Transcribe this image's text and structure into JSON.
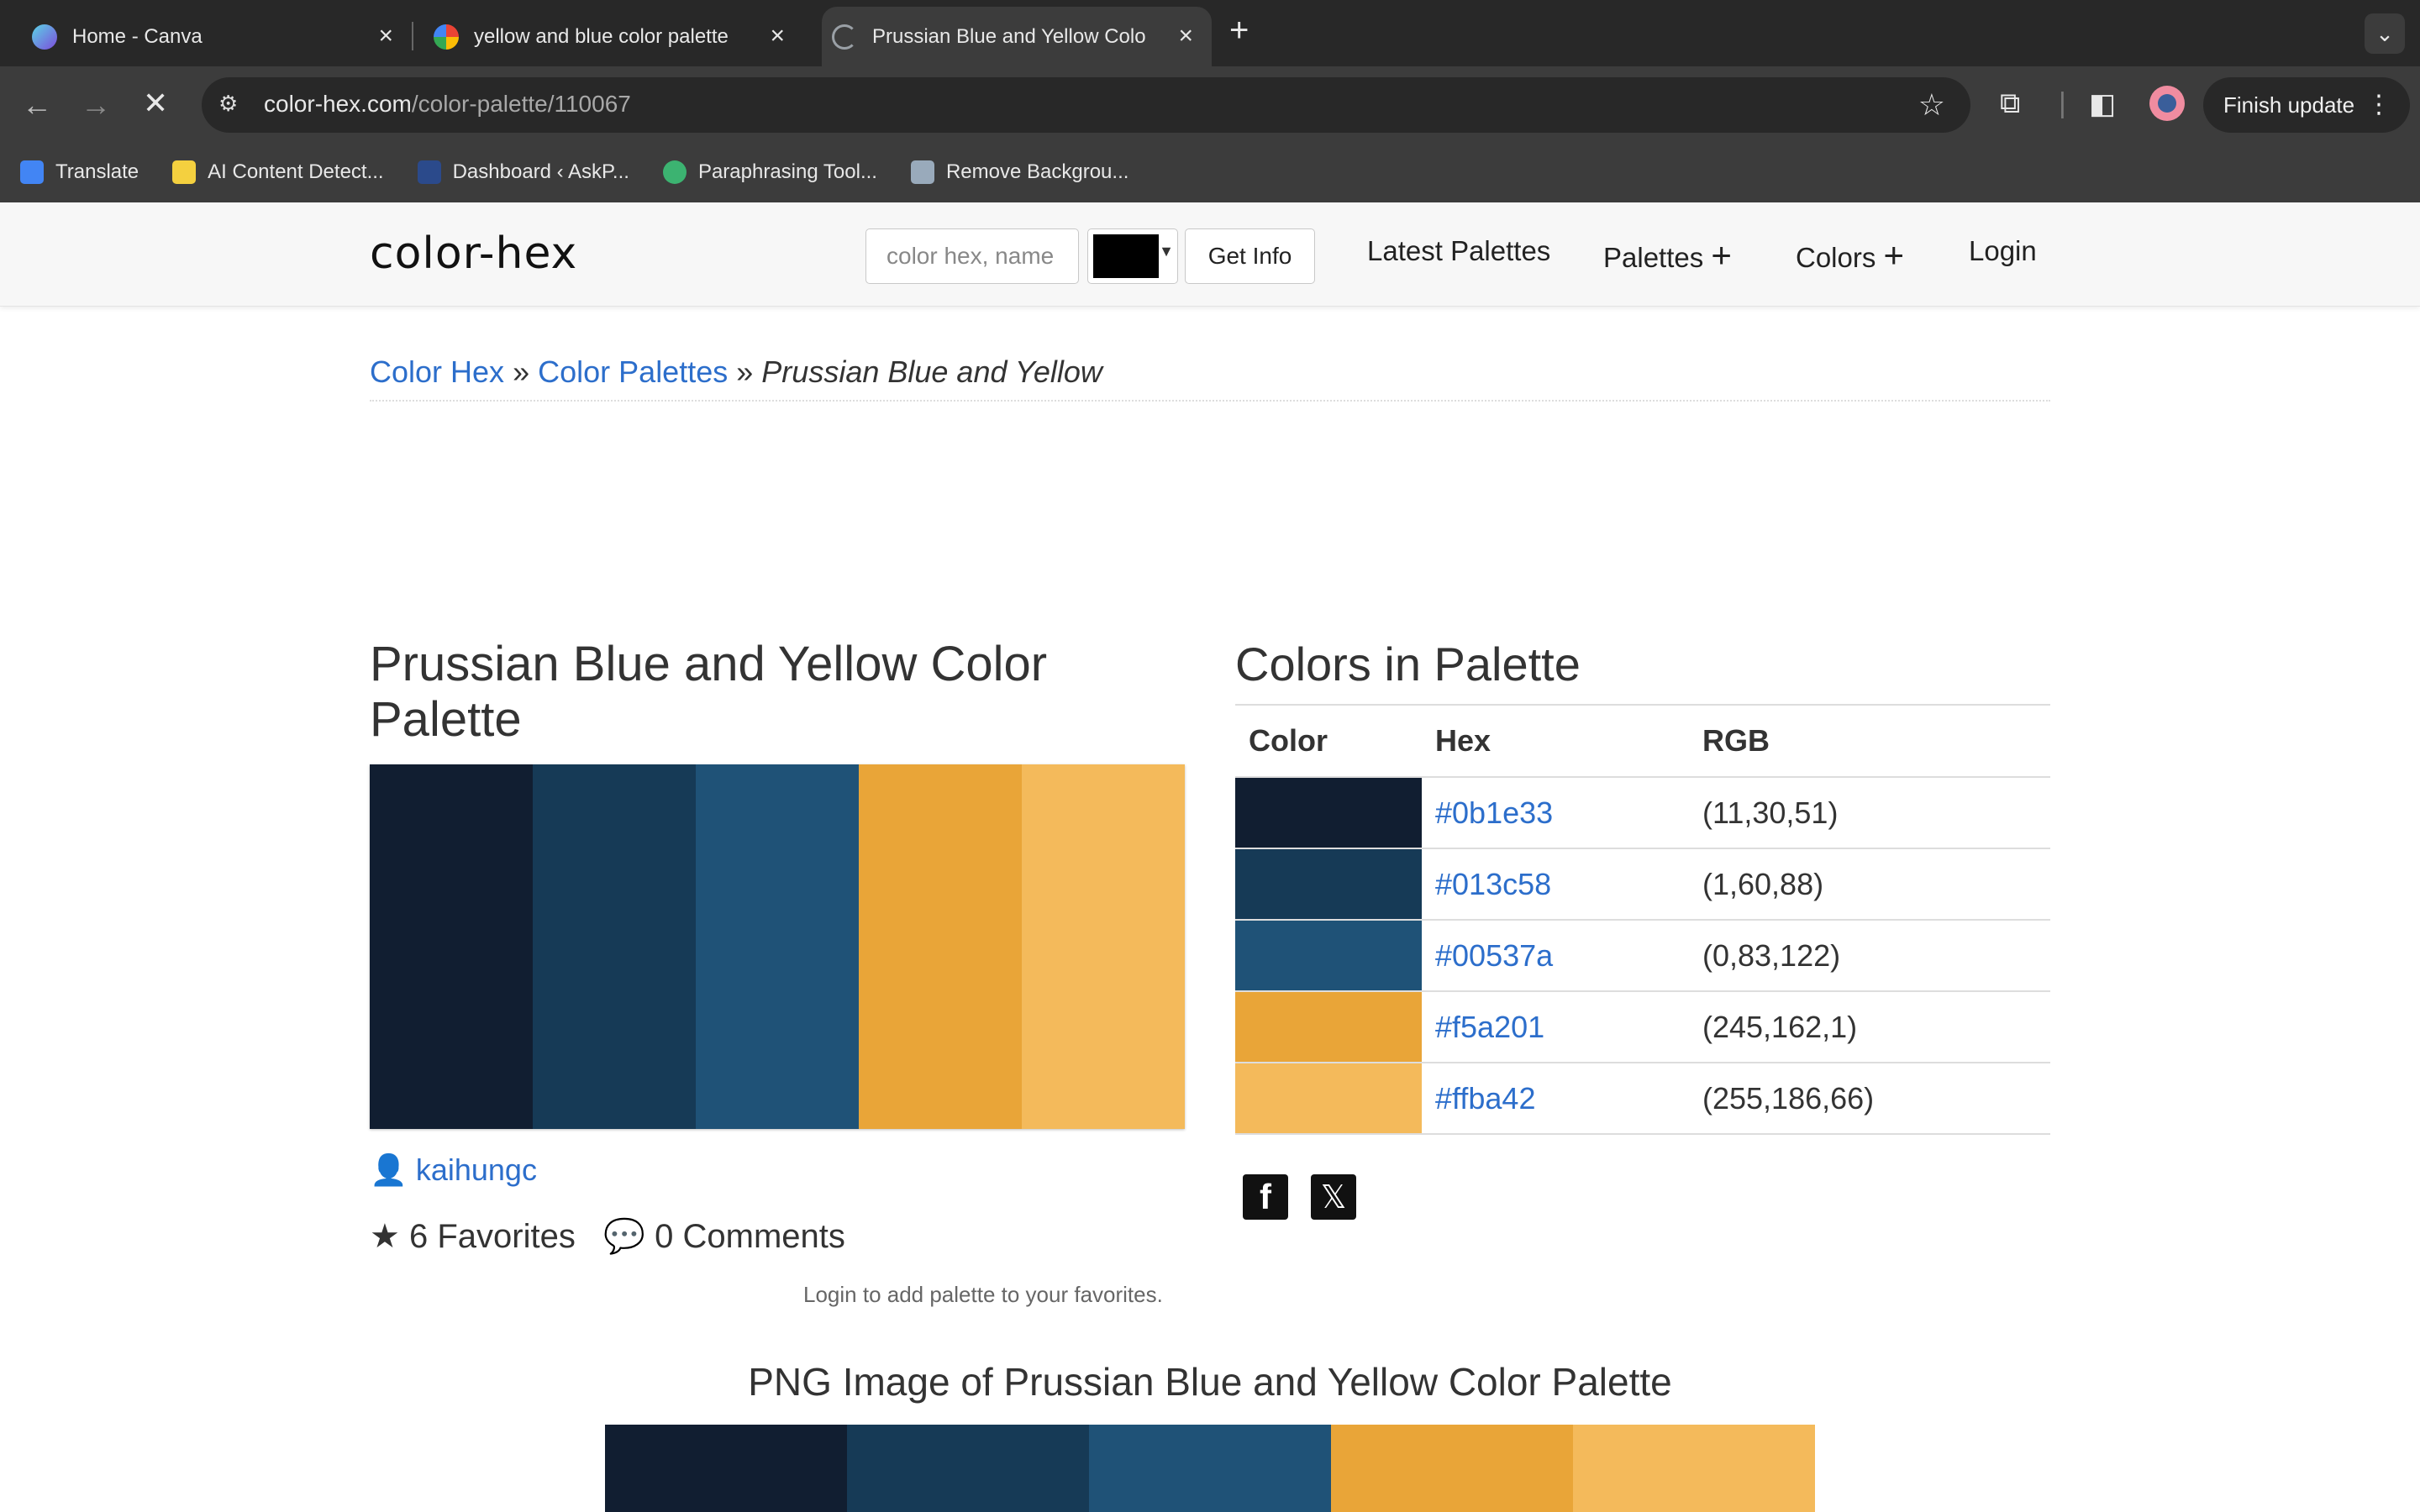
{
  "browser": {
    "tabs": [
      {
        "title": "Home - Canva",
        "favicon_color": "#7d4cdb"
      },
      {
        "title": "yellow and blue color palette",
        "favicon_color": "#ffffff"
      },
      {
        "title": "Prussian Blue and Yellow Colo",
        "favicon_color": "#9aa0a6",
        "active": true
      }
    ],
    "url_domain": "color-hex.com",
    "url_path": "/color-palette/110067",
    "finish_update_label": "Finish update",
    "bookmarks": [
      {
        "label": "Translate",
        "color": "#4285f4"
      },
      {
        "label": "AI Content Detect...",
        "color": "#f4d03f"
      },
      {
        "label": "Dashboard ‹ AskP...",
        "color": "#2b4a8b"
      },
      {
        "label": "Paraphrasing Tool...",
        "color": "#3cb371"
      },
      {
        "label": "Remove Backgrou...",
        "color": "#9ab"
      }
    ]
  },
  "site": {
    "logo": "color-hex",
    "search_placeholder": "color hex, name",
    "get_info_label": "Get Info",
    "nav": {
      "latest": "Latest Palettes",
      "palettes": "Palettes",
      "colors": "Colors",
      "login": "Login"
    }
  },
  "breadcrumb": {
    "home": "Color Hex",
    "sep": "»",
    "section": "Color Palettes",
    "current": "Prussian Blue and Yellow"
  },
  "palette": {
    "title": "Prussian Blue and Yellow Color Palette",
    "author": "kaihungc",
    "favorites": "6 Favorites",
    "comments": "0 Comments",
    "login_note": "Login to add palette to your favorites.",
    "colors_title": "Colors in Palette",
    "table_headers": {
      "color": "Color",
      "hex": "Hex",
      "rgb": "RGB"
    },
    "colors": [
      {
        "hex": "#0b1e33",
        "rgb": "(11,30,51)"
      },
      {
        "hex": "#013c58",
        "rgb": "(1,60,88)"
      },
      {
        "hex": "#00537a",
        "rgb": "(0,83,122)"
      },
      {
        "hex": "#f5a201",
        "rgb": "(245,162,1)"
      },
      {
        "hex": "#ffba42",
        "rgb": "(255,186,66)"
      }
    ],
    "swatch_display": [
      "#111e31",
      "#163a56",
      "#1f5277",
      "#e9a538",
      "#f4ba5b"
    ],
    "png_title": "PNG Image of Prussian Blue and Yellow Color Palette"
  }
}
